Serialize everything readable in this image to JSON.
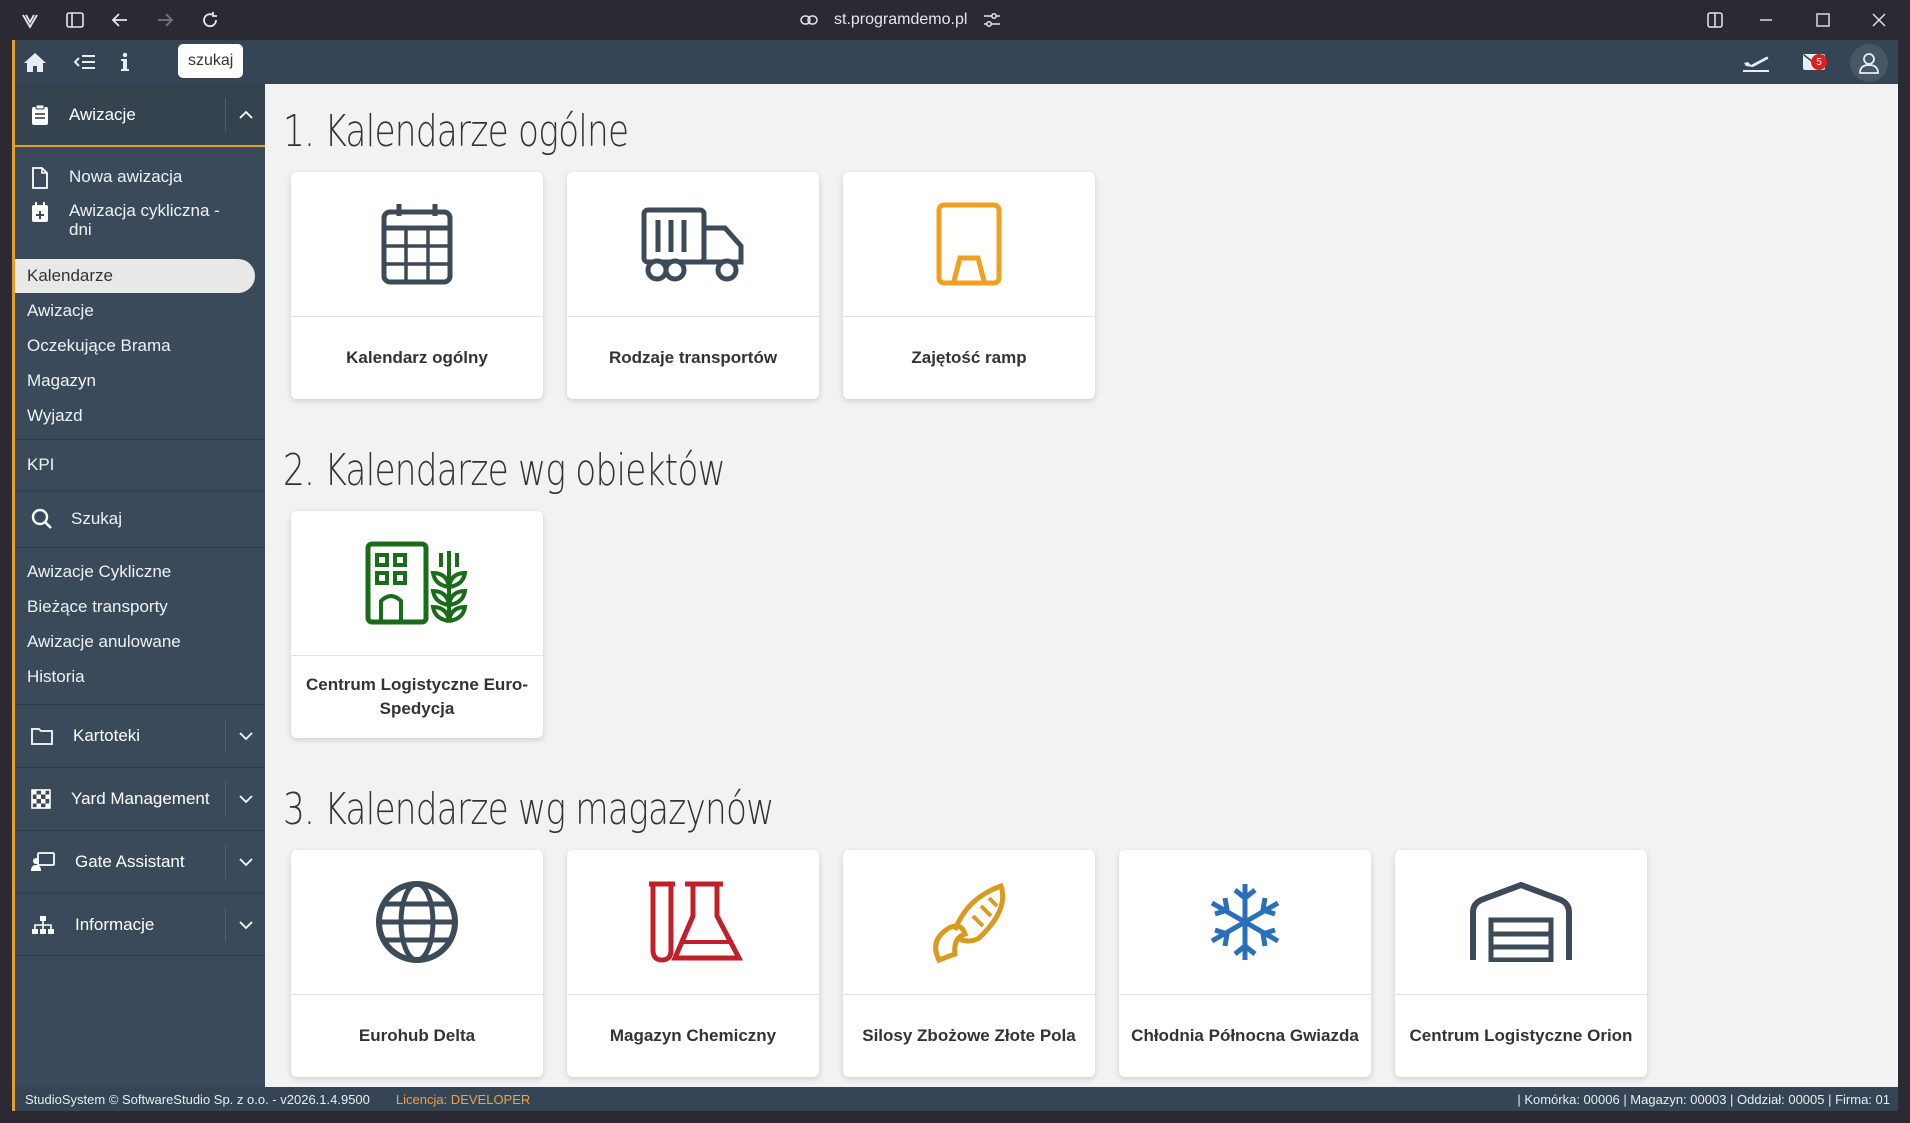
{
  "browser": {
    "url": "st.programdemo.pl"
  },
  "topbar": {
    "search_tooltip": "szukaj",
    "mail_count": "5"
  },
  "sidebar": {
    "section": "Awizacje",
    "subitems": [
      "Nowa awizacja",
      "Awizacja cykliczna - dni"
    ],
    "group1": [
      "Kalendarze",
      "Awizacje",
      "Oczekujące Brama",
      "Magazyn",
      "Wyjazd"
    ],
    "kpi": "KPI",
    "search": "Szukaj",
    "group2": [
      "Awizacje Cykliczne",
      "Bieżące transporty",
      "Awizacje anulowane",
      "Historia"
    ],
    "sections": [
      "Kartoteki",
      "Yard Management",
      "Gate Assistant",
      "Informacje"
    ]
  },
  "main": {
    "section1": {
      "title": "1. Kalendarze ogólne",
      "cards": [
        "Kalendarz ogólny",
        "Rodzaje transportów",
        "Zajętość ramp"
      ]
    },
    "section2": {
      "title": "2. Kalendarze wg obiektów",
      "cards": [
        "Centrum Logistyczne Euro-Spedycja"
      ]
    },
    "section3": {
      "title": "3. Kalendarze wg magazynów",
      "cards": [
        "Eurohub Delta",
        "Magazyn Chemiczny",
        "Silosy Zbożowe Złote Pola",
        "Chłodnia Północna Gwiazda",
        "Centrum Logistyczne Orion"
      ]
    }
  },
  "colors": {
    "sidebar": "#3b4a5a",
    "accent": "#e0a030",
    "icon_dark": "#3d4a58",
    "icon_orange": "#f0a020",
    "icon_green": "#1a6b1a",
    "icon_red": "#c0202a",
    "icon_gold": "#d99a20",
    "icon_blue": "#2a6fb8"
  },
  "footer": {
    "left": "StudioSystem © SoftwareStudio Sp. z o.o. - v2026.1.4.9500",
    "license": "Licencja: DEVELOPER",
    "right": "| Komórka: 00006 | Magazyn: 00003 | Oddział: 00005 | Firma: 01"
  }
}
